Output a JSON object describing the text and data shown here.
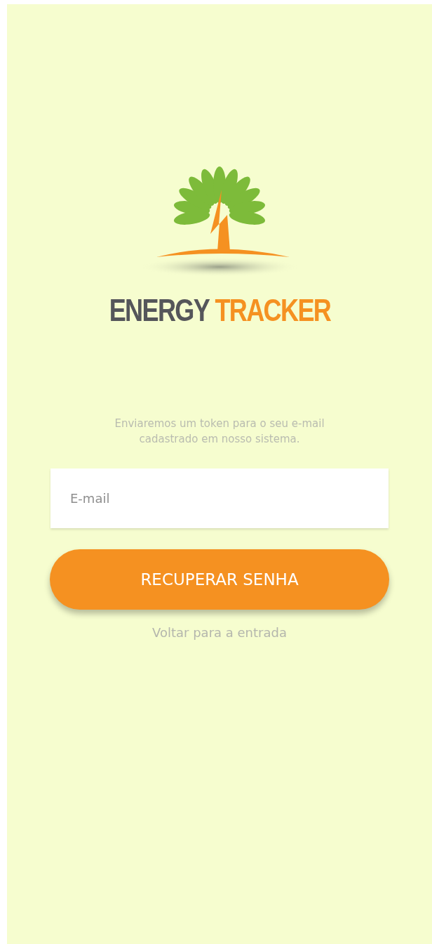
{
  "logo": {
    "first_word": "ENERGY",
    "second_word": "TRACKER"
  },
  "description": "Enviaremos um token para o seu e-mail cadastrado em nosso sistema.",
  "email_field": {
    "placeholder": "E-mail"
  },
  "submit_button": {
    "label": "RECUPERAR SENHA"
  },
  "back_link": {
    "label": "Voltar para a entrada"
  }
}
